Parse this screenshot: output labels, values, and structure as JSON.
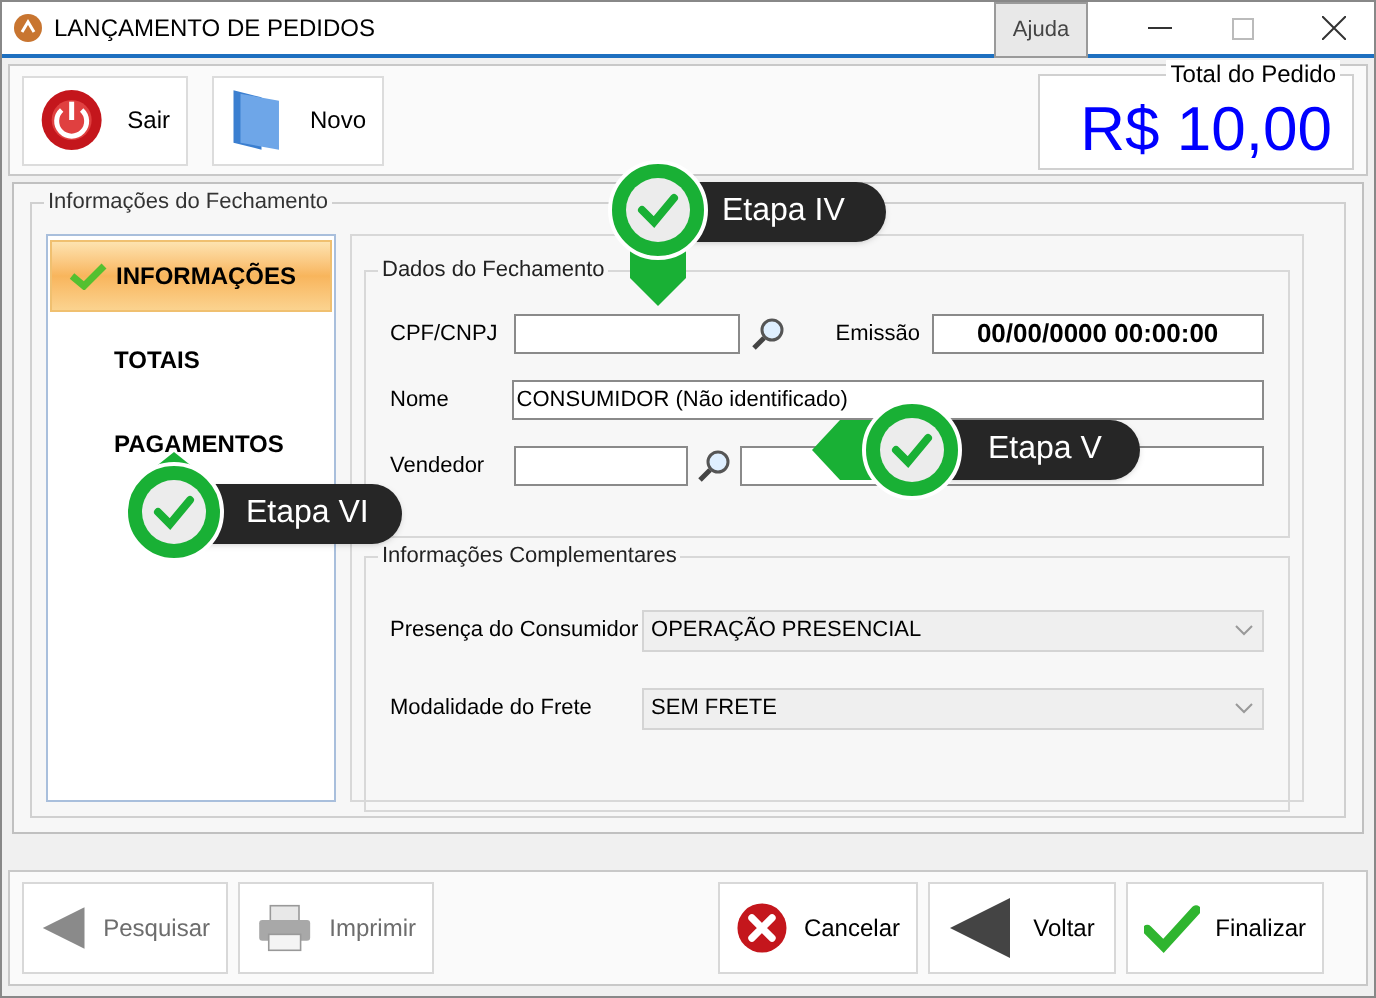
{
  "window": {
    "title": "LANÇAMENTO DE PEDIDOS",
    "help_button": "Ajuda"
  },
  "toolbar": {
    "buttons": [
      {
        "label": "Sair",
        "kind": "power"
      },
      {
        "label": "Novo",
        "kind": "folder"
      }
    ]
  },
  "total": {
    "label": "Total do Pedido",
    "value": "R$ 10,00"
  },
  "closing": {
    "title": "Informações do Fechamento",
    "nav": [
      {
        "label": "INFORMAÇÕES",
        "selected": true
      },
      {
        "label": "TOTAIS",
        "selected": false
      },
      {
        "label": "PAGAMENTOS",
        "selected": false
      }
    ],
    "details": {
      "title": "Dados do Fechamento",
      "cpf_label": "CPF/CNPJ",
      "issue_label": "Emissão",
      "issue_value": "00/00/0000 00:00:00",
      "name_label": "Nome",
      "name_value": "CONSUMIDOR (Não identificado)",
      "seller_label": "Vendedor"
    },
    "extra": {
      "title": "Informações Complementares",
      "fields": [
        {
          "label": "Presença do Consumidor",
          "value": "OPERAÇÃO PRESENCIAL"
        },
        {
          "label": "Modalidade do Frete",
          "value": "SEM FRETE"
        }
      ]
    }
  },
  "callouts": [
    {
      "label": "Etapa IV"
    },
    {
      "label": "Etapa V"
    },
    {
      "label": "Etapa VI"
    }
  ],
  "footer": {
    "buttons": [
      {
        "label": "Pesquisar",
        "kind": "back",
        "disabled": true
      },
      {
        "label": "Imprimir",
        "kind": "print",
        "disabled": true
      },
      {
        "label": "Cancelar",
        "kind": "cancel",
        "disabled": false
      },
      {
        "label": "Voltar",
        "kind": "back",
        "disabled": false
      },
      {
        "label": "Finalizar",
        "kind": "check",
        "disabled": false
      }
    ]
  }
}
